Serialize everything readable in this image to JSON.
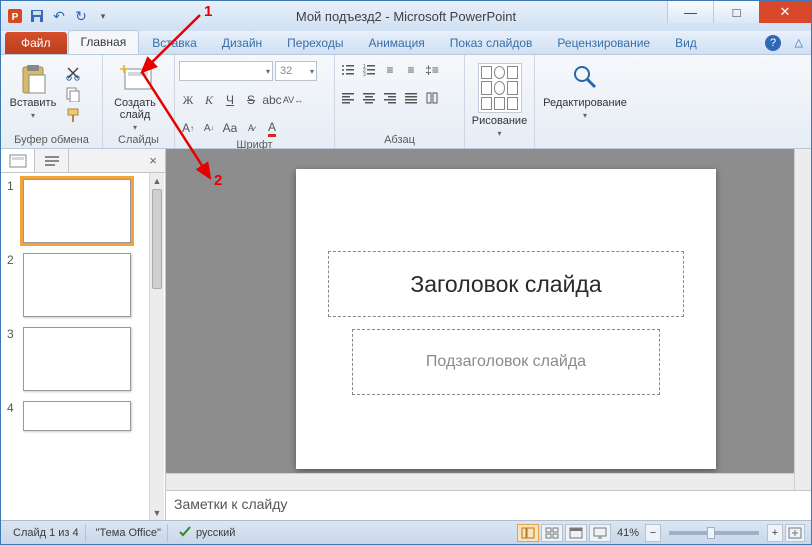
{
  "title": "Мой подъезд2 - Microsoft PowerPoint",
  "tabs": {
    "file": "Файл",
    "items": [
      "Главная",
      "Вставка",
      "Дизайн",
      "Переходы",
      "Анимация",
      "Показ слайдов",
      "Рецензирование",
      "Вид"
    ],
    "active_index": 0
  },
  "ribbon": {
    "clipboard": {
      "label": "Буфер обмена",
      "paste": "Вставить"
    },
    "slides": {
      "label": "Слайды",
      "new_slide": "Создать слайд"
    },
    "font": {
      "label": "Шрифт",
      "size": "32"
    },
    "paragraph": {
      "label": "Абзац"
    },
    "drawing": {
      "label": "Рисование",
      "button": "Рисование"
    },
    "editing": {
      "label": "Редактирование",
      "button": "Редактирование"
    }
  },
  "thumbnails": [
    {
      "n": "1",
      "selected": true
    },
    {
      "n": "2",
      "selected": false
    },
    {
      "n": "3",
      "selected": false
    },
    {
      "n": "4",
      "selected": false
    }
  ],
  "slide": {
    "title_placeholder": "Заголовок слайда",
    "subtitle_placeholder": "Подзаголовок слайда"
  },
  "notes_placeholder": "Заметки к слайду",
  "status": {
    "slide_info": "Слайд 1 из 4",
    "theme": "\"Тема Office\"",
    "language": "русский",
    "zoom": "41%"
  },
  "annotations": {
    "one": "1",
    "two": "2"
  }
}
